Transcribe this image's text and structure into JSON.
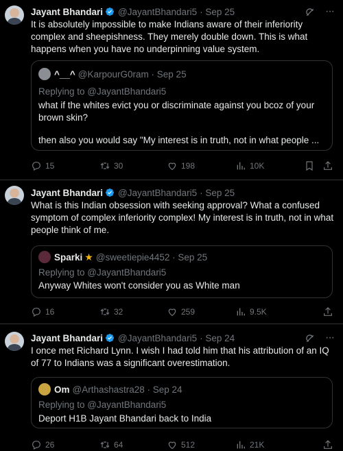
{
  "colors": {
    "background": "#000000",
    "text": "#e7e9ea",
    "muted": "#71767b",
    "verified": "#1d9bf0",
    "border": "#2f3336",
    "star": "#f4b400"
  },
  "tweets": [
    {
      "name": "Jayant Bhandari",
      "handle": "@JayantBhandari5",
      "date": "· Sep 25",
      "text": "It is absolutely impossible to make Indians aware of their inferiority complex and sheepishness. They merely double down. This is what happens when you have no underpinning value system.",
      "quote": {
        "name": "^__^",
        "handle": "@KarpourG0ram · Sep 25",
        "replying": "Replying to @JayantBhandari5",
        "text1": "what if the whites evict you or discriminate against you bcoz of your brown skin?",
        "text2": "then also you would say \"My interest is in truth, not in what people ..."
      },
      "stats": {
        "replies": "15",
        "retweets": "30",
        "likes": "198",
        "views": "10K"
      }
    },
    {
      "name": "Jayant Bhandari",
      "handle": "@JayantBhandari5",
      "date": "· Sep 25",
      "text": "What is this Indian obsession with seeking approval? What a confused symptom of complex inferiority complex! My interest is in truth, not in what people think of me.",
      "quote": {
        "name": "Sparki",
        "handle": "@sweetiepie4452 · Sep 25",
        "replying": "Replying to @JayantBhandari5",
        "text1": "Anyway Whites won't consider you as White man"
      },
      "stats": {
        "replies": "16",
        "retweets": "32",
        "likes": "259",
        "views": "9.5K"
      }
    },
    {
      "name": "Jayant Bhandari",
      "handle": "@JayantBhandari5",
      "date": "· Sep 24",
      "text": "I once met Richard Lynn. I wish I had told him that his attribution of an IQ of 77 to Indians was a significant overestimation.",
      "quote": {
        "name": "Om",
        "handle": "@Arthashastra28 · Sep 24",
        "replying": "Replying to @JayantBhandari5",
        "text1": "Deport H1B Jayant Bhandari back to India"
      },
      "stats": {
        "replies": "26",
        "retweets": "64",
        "likes": "512",
        "views": "21K"
      }
    }
  ]
}
